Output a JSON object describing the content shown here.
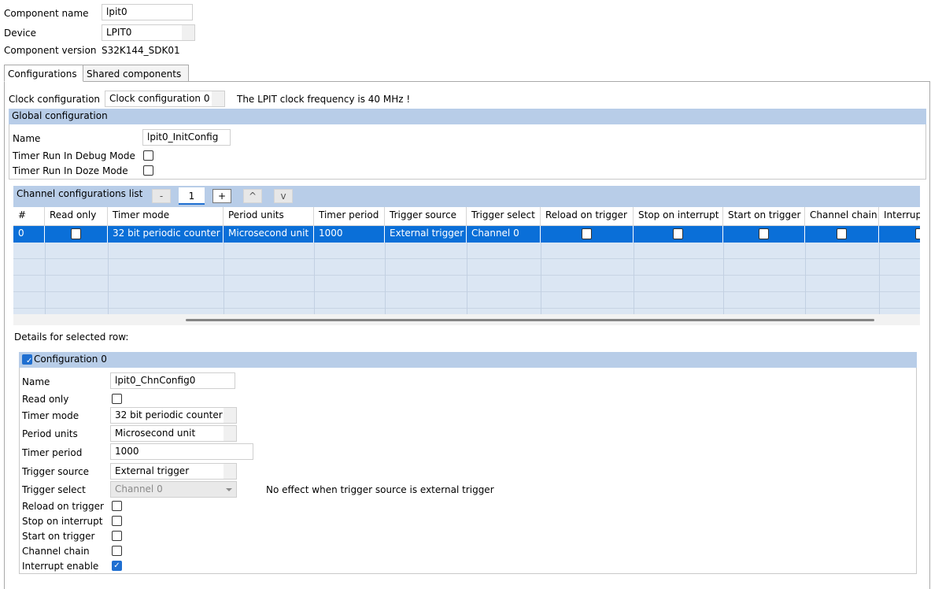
{
  "component": {
    "name_label": "Component name",
    "name_value": "lpit0",
    "device_label": "Device",
    "device_value": "LPIT0",
    "version_label": "Component version",
    "version_value": "S32K144_SDK01"
  },
  "tabs": [
    {
      "label": "Configurations",
      "active": true
    },
    {
      "label": "Shared components",
      "active": false
    }
  ],
  "clock": {
    "label": "Clock configuration",
    "value": "Clock configuration 0",
    "message": "The LPIT clock frequency is 40 MHz !"
  },
  "global": {
    "title": "Global configuration",
    "name_label": "Name",
    "name_value": "lpit0_InitConfig",
    "debug_label": "Timer Run In Debug Mode",
    "debug_checked": false,
    "doze_label": "Timer Run In Doze Mode",
    "doze_checked": false
  },
  "channel_list": {
    "title": "Channel configurations list",
    "minus": "-",
    "count": "1",
    "plus": "+",
    "up": "^",
    "down": "v"
  },
  "table": {
    "columns": [
      "#",
      "Read only",
      "Timer mode",
      "Period units",
      "Timer period",
      "Trigger source",
      "Trigger select",
      "Reload on trigger",
      "Stop on interrupt",
      "Start on trigger",
      "Channel chain",
      "Interrup"
    ],
    "rows": [
      {
        "index": "0",
        "read_only": false,
        "timer_mode": "32 bit periodic counter",
        "period_units": "Microsecond unit",
        "timer_period": "1000",
        "trigger_source": "External trigger",
        "trigger_select": "Channel 0",
        "reload_on_trigger": false,
        "stop_on_interrupt": false,
        "start_on_trigger": false,
        "channel_chain": false
      }
    ]
  },
  "details": {
    "caption": "Details for selected row:",
    "section_title": "Configuration 0",
    "section_checked": true,
    "name_label": "Name",
    "name_value": "lpit0_ChnConfig0",
    "read_only_label": "Read only",
    "read_only_checked": false,
    "timer_mode_label": "Timer mode",
    "timer_mode_value": "32 bit periodic counter",
    "period_units_label": "Period units",
    "period_units_value": "Microsecond unit",
    "timer_period_label": "Timer period",
    "timer_period_value": "1000",
    "trigger_source_label": "Trigger source",
    "trigger_source_value": "External trigger",
    "trigger_select_label": "Trigger select",
    "trigger_select_value": "Channel 0",
    "trigger_select_note": "No effect when trigger source is external trigger",
    "reload_label": "Reload on trigger",
    "reload_checked": false,
    "stop_label": "Stop on interrupt",
    "stop_checked": false,
    "start_label": "Start on trigger",
    "start_checked": false,
    "chain_label": "Channel chain",
    "chain_checked": false,
    "interrupt_label": "Interrupt enable",
    "interrupt_checked": true
  },
  "colors": {
    "section_header": "#b8cde8",
    "selected_row": "#0a6fd8",
    "grid_background": "#dbe6f3",
    "checkbox_checked": "#1f6fd1"
  },
  "icons": {
    "checkmark": "check-icon",
    "dropdown": "chevron-down-icon"
  }
}
